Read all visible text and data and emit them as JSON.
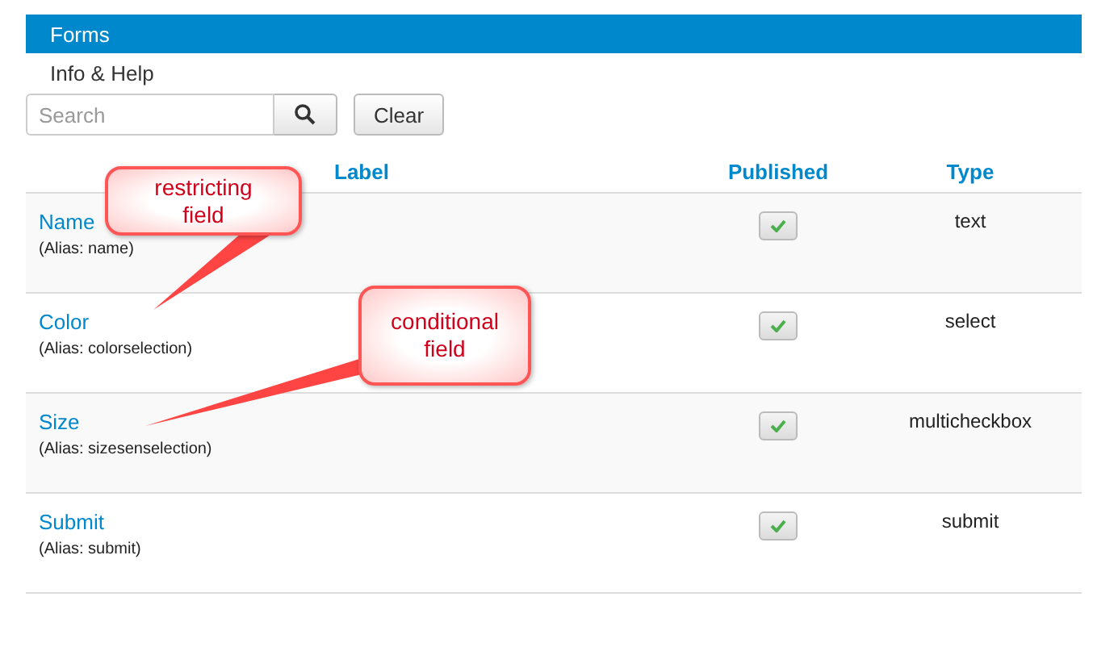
{
  "header": {
    "title": "Forms"
  },
  "help_link": "Info & Help",
  "search": {
    "placeholder": "Search",
    "clear_button": "Clear"
  },
  "table": {
    "columns": [
      "Label",
      "Published",
      "Type"
    ],
    "rows": [
      {
        "label": "Name",
        "alias": "(Alias: name)",
        "published": true,
        "type": "text"
      },
      {
        "label": "Color",
        "alias": "(Alias: colorselection)",
        "published": true,
        "type": "select"
      },
      {
        "label": "Size",
        "alias": "(Alias: sizesenselection)",
        "published": true,
        "type": "multicheckbox"
      },
      {
        "label": "Submit",
        "alias": "(Alias: submit)",
        "published": true,
        "type": "submit"
      }
    ]
  },
  "callouts": [
    {
      "text": "restricting field"
    },
    {
      "text": "conditional field"
    }
  ]
}
